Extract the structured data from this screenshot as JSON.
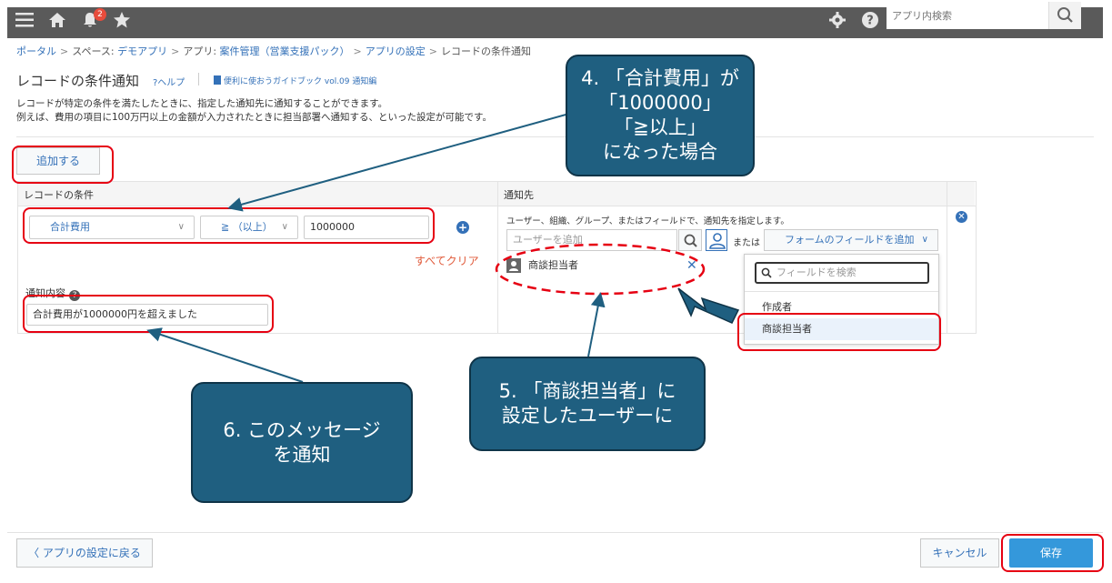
{
  "topbar": {
    "notification_count": "2",
    "search_placeholder": "アプリ内検索",
    "bg_color": "#5a5a5a"
  },
  "breadcrumb": {
    "portal": "ポータル",
    "space_prefix": "スペース: ",
    "space": "デモアプリ",
    "app_prefix": "アプリ: ",
    "app": "案件管理（営業支援パック）",
    "settings": "アプリの設定",
    "current": "レコードの条件通知",
    "separator": ">"
  },
  "header": {
    "title": "レコードの条件通知",
    "help": "?ヘルプ",
    "guide": "便利に使おうガイドブック vol.09 通知編",
    "desc_line1": "レコードが特定の条件を満たしたときに、指定した通知先に通知することができます。",
    "desc_line2": "例えば、費用の項目に100万円以上の金額が入力されたときに担当部署へ通知する、といった設定が可能です。"
  },
  "actions": {
    "add": "追加する",
    "clear_all": "すべてクリア",
    "back": "アプリの設定に戻る",
    "cancel": "キャンセル",
    "save": "保存"
  },
  "table": {
    "col_condition": "レコードの条件",
    "col_recipient": "通知先",
    "condition": {
      "field": "合計費用",
      "operator": "≧ （以上）",
      "value": "1000000"
    },
    "message_label": "通知内容",
    "message_value": "合計費用が1000000円を超えました",
    "recipient": {
      "description": "ユーザー、組織、グループ、またはフィールドで、通知先を指定します。",
      "user_placeholder": "ユーザーを追加",
      "or": "または",
      "add_field": "フォームのフィールドを追加",
      "entity": "商談担当者"
    }
  },
  "field_dropdown": {
    "search_placeholder": "フィールドを検索",
    "options": [
      "作成者",
      "商談担当者"
    ],
    "selected": "商談担当者"
  },
  "callouts": {
    "c4": "4. 「合計費用」が\n「1000000」\n「≧以上」\nになった場合",
    "c5": "5. 「商談担当者」に\n設定したユーザーに",
    "c6": "6. このメッセージ\nを通知"
  },
  "colors": {
    "link": "#3471b8",
    "highlight": "#e60012",
    "callout": "#1f5f80",
    "save_button": "#3498db"
  }
}
